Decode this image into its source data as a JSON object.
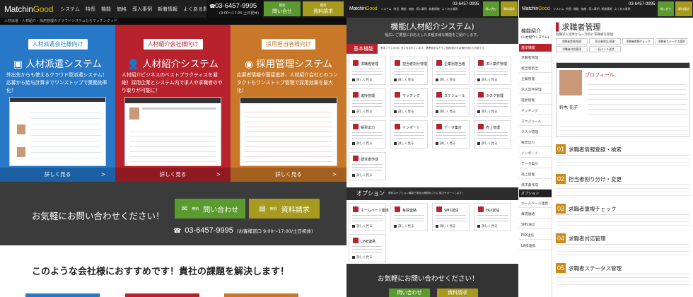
{
  "colors": {
    "red": "#b8222d",
    "blue": "#2878c8",
    "orange": "#c9782a",
    "green": "#5b9a2e",
    "gold": "#a69a1f",
    "dark": "#1f1f1f"
  },
  "header": {
    "logo_match": "Matchin",
    "logo_good": "Good",
    "nav": [
      "システム",
      "特長",
      "機能",
      "価格",
      "導入事例",
      "新着情報",
      "よくある質問"
    ],
    "phone": "03-6457-9995",
    "hours": "(9:00〜17:00 土日祝休)",
    "btn_inquiry_small": "無料",
    "btn_inquiry": "問い合せ",
    "btn_docs_small": "無料",
    "btn_docs": "資料請求"
  },
  "sub_header": "人材派遣・人材紹介・採用管理のクラウドシステムならマッチングッド",
  "services": [
    {
      "tag": "人材派遣会社様向け",
      "title": "人材派遣システム",
      "desc": "外出先からも使えるクラウド型派遣システム！応募から給与計算までワンストップで業務効率化！",
      "more": "詳しく見る"
    },
    {
      "tag": "人材紹介会社様向け",
      "title": "人材紹介システム",
      "desc": "人材紹介ビジネスのベストプラクティスを凝縮！採用企業とシステム内で求人や求職者のやり取りが可能に！",
      "more": "詳しく見る"
    },
    {
      "tag": "採用担当者様向け",
      "title": "採用管理システム",
      "desc": "応募者情報や面接進捗、人材紹介会社とのコンタクトもワンストップ管理で採用効果を最大化！",
      "more": "詳しく見る"
    }
  ],
  "cta": {
    "question": "お気軽にお問い合わせください！",
    "btn1_small": "無料",
    "btn1": "問い合わせ",
    "btn2_small": "無料",
    "btn2": "資料請求",
    "phone": "03-6457-9995",
    "hours": "(お客様窓口 9:00〜17:00/土日祝休)"
  },
  "recommend": "このような会社様におすすめです！貴社の課題を解決します！",
  "p2": {
    "logo_match": "Matchin",
    "logo_good": "Good",
    "phone": "03-6457-9995",
    "title": "機能(人材紹介システム)",
    "subtitle": "幅広いご要望にお応えした多種多様な機能をご紹介します。",
    "basic": "基本機能",
    "basic_desc": "基本プランの中に全て含まれています。帳票設定などもご相談頂ければ個別対応も可能です。",
    "functions": [
      "求職者管理",
      "担当者割分管理",
      "企業別担当者",
      "求人案件管理",
      "進捗管理",
      "マッチング",
      "スケジュール",
      "タスク管理",
      "帳票出力",
      "インポート",
      "データ集計",
      "売上管理",
      "請求書作成"
    ],
    "option": "オプション",
    "option_desc": "便利なオプション機能で貴社の業務をさらに強力サポートします！",
    "options": [
      "ホームページ連携",
      "毎週連絡",
      "SMS送信",
      "FAX送信",
      "LINE連携"
    ],
    "more": "詳しく見る",
    "cta_q": "お気軽にお問い合わせください！",
    "cta_btn1": "問い合わせ",
    "cta_btn2": "資料請求"
  },
  "p3": {
    "logo_match": "Matchin",
    "logo_good": "Good",
    "phone": "03-6457-9995",
    "title": "機能紹介",
    "title_sub": "(人材紹介システム)",
    "side_header": "基本機能",
    "side": [
      "求職者管理",
      "担当者割当",
      "企業管理",
      "求人案件管理",
      "進捗管理",
      "マッチング",
      "スケジュール",
      "タスク管理",
      "帳票出力",
      "インポート",
      "データ集計",
      "売上管理",
      "請求書作成"
    ],
    "side_option": "オプション",
    "side_options": [
      "ホームページ連携",
      "毎週連絡",
      "SMS送信",
      "FAX送信",
      "LINE連携"
    ],
    "page_title": "求職者管理",
    "page_desc": "各種求人案件から一元的に求職者を管理",
    "tabs": [
      "求職者管理/検索",
      "担当者割当/変更",
      "求職者書類チェック",
      "求職者ステータス管理",
      "求職者対応管理",
      "一括メール送信"
    ],
    "profile": "プロフィール",
    "person": "鈴木 花子",
    "sections": [
      {
        "num": "01",
        "title": "求職者情報登録・検索"
      },
      {
        "num": "02",
        "title": "担当者割り分け・変更"
      },
      {
        "num": "03",
        "title": "求職者重複チェック"
      },
      {
        "num": "04",
        "title": "求職者対応管理"
      },
      {
        "num": "05",
        "title": "求職者ステータス管理"
      }
    ]
  }
}
